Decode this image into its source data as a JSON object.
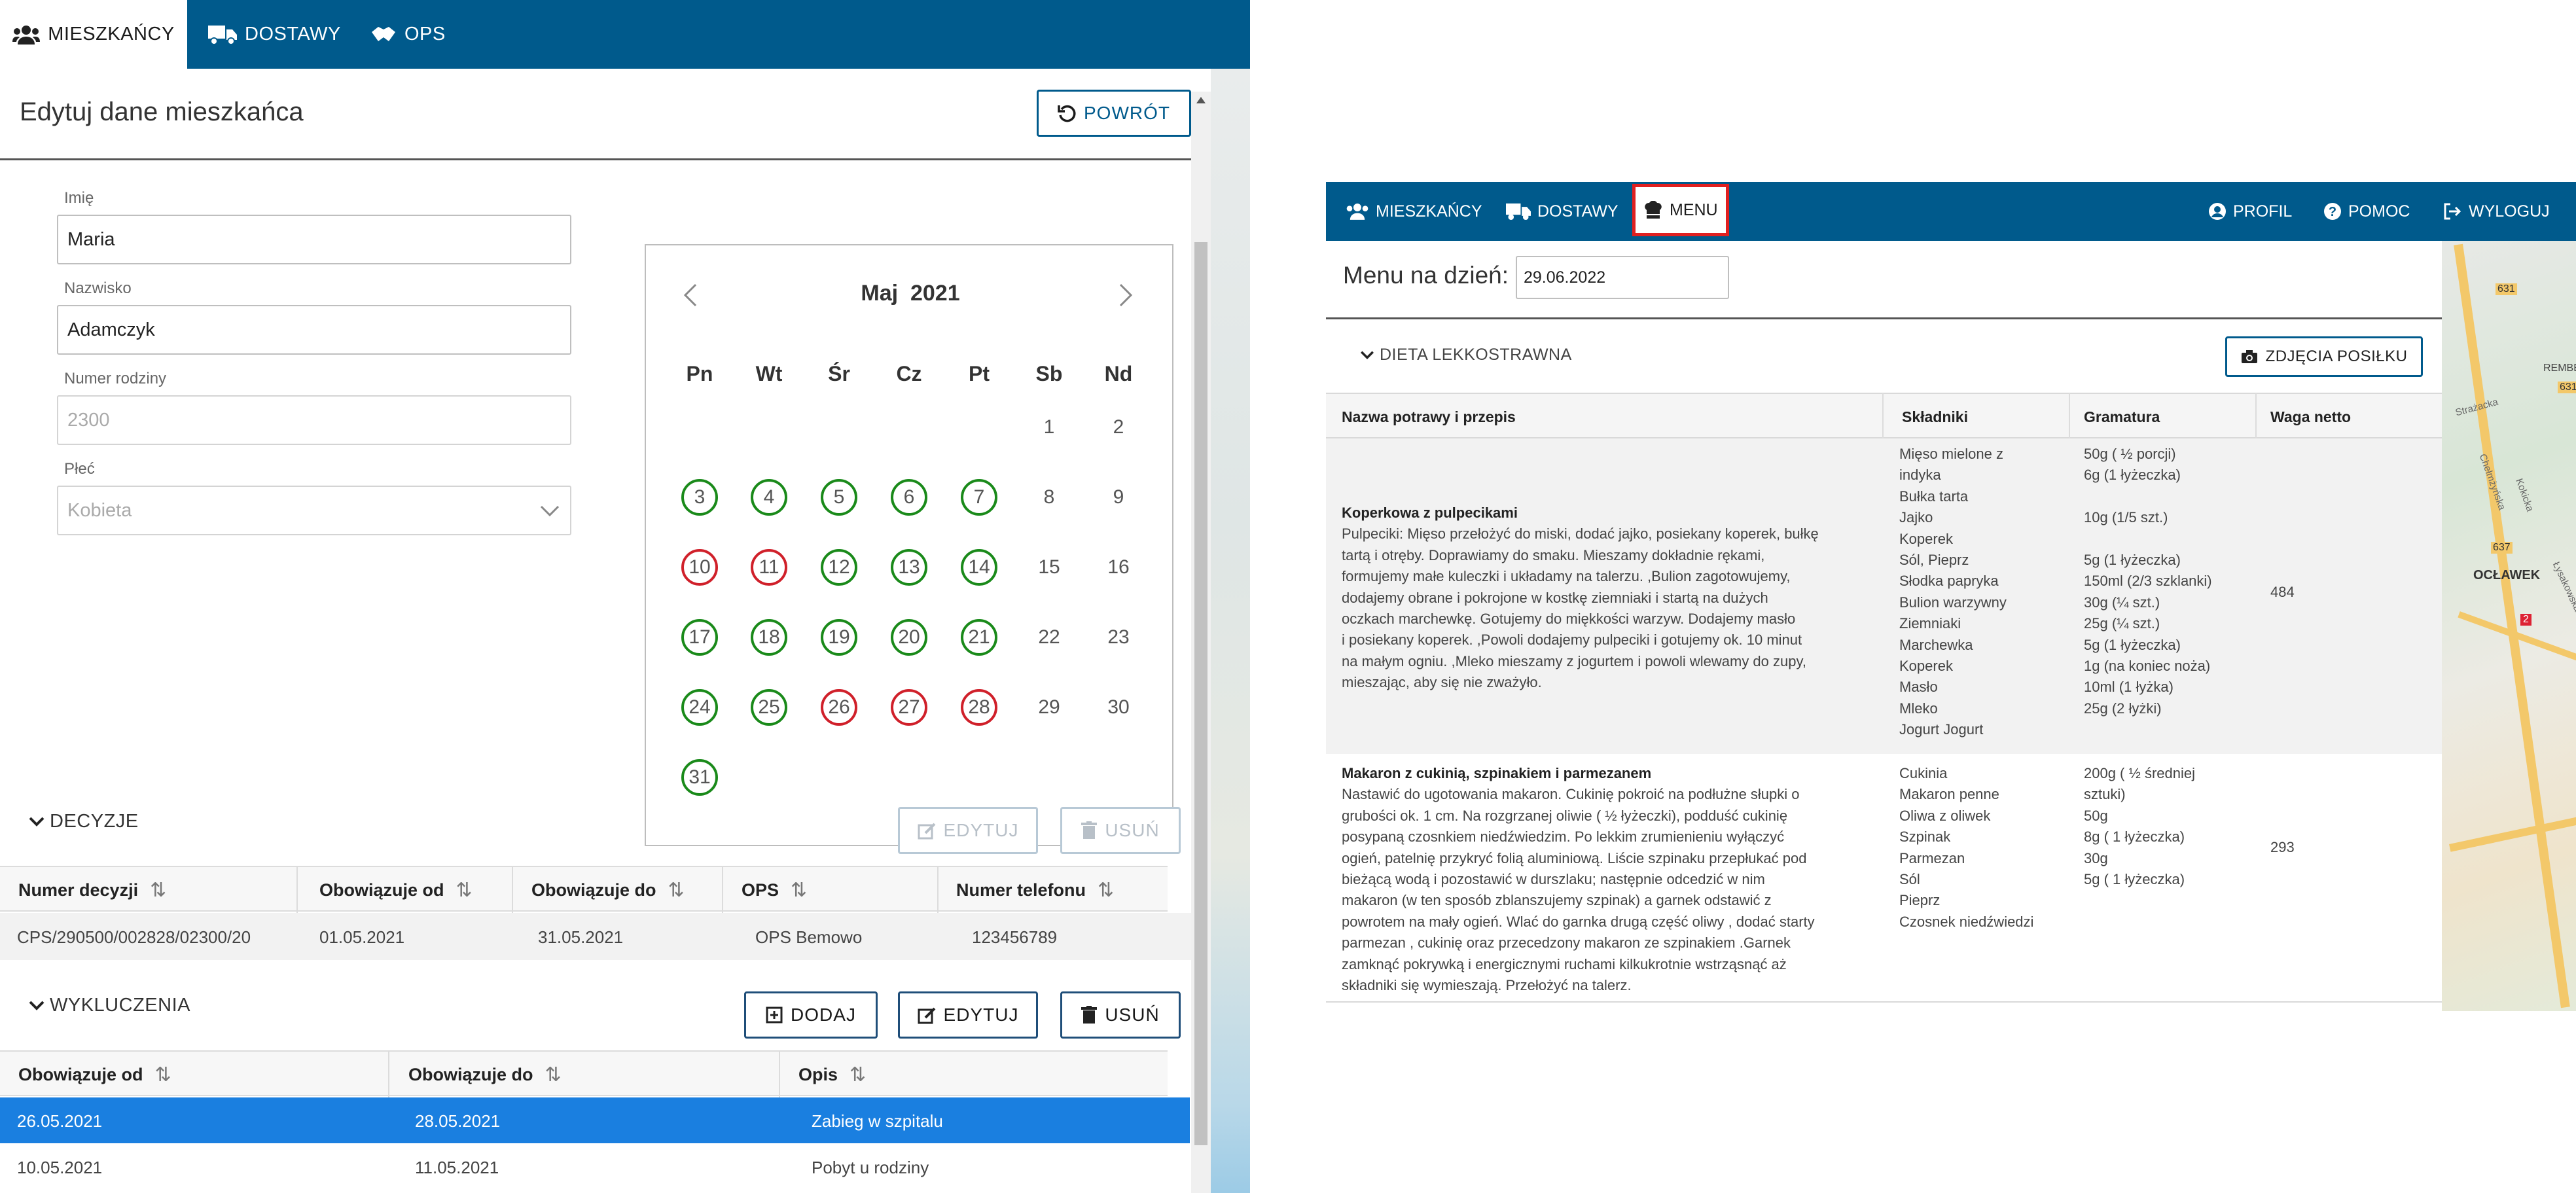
{
  "left": {
    "nav": [
      {
        "label": "MIESZKAŃCY",
        "icon": "users-icon",
        "active": true
      },
      {
        "label": "DOSTAWY",
        "icon": "truck-icon",
        "active": false
      },
      {
        "label": "OPS",
        "icon": "handshake-icon",
        "active": false
      }
    ],
    "page_title": "Edytuj dane mieszkańca",
    "back_button": "POWRÓT",
    "form": {
      "first_name_label": "Imię",
      "first_name_value": "Maria",
      "last_name_label": "Nazwisko",
      "last_name_value": "Adamczyk",
      "family_no_label": "Numer rodziny",
      "family_no_value": "2300",
      "sex_label": "Płeć",
      "sex_value": "Kobieta"
    },
    "calendar": {
      "month": "Maj",
      "year": "2021",
      "weekdays": [
        "Pn",
        "Wt",
        "Śr",
        "Cz",
        "Pt",
        "Sb",
        "Nd"
      ],
      "colors": {
        "green": "#1a8a1a",
        "red": "#d0202a"
      },
      "days": [
        {
          "d": "1",
          "s": ""
        },
        {
          "d": "2",
          "s": ""
        },
        {
          "d": "3",
          "s": "green"
        },
        {
          "d": "4",
          "s": "green"
        },
        {
          "d": "5",
          "s": "green"
        },
        {
          "d": "6",
          "s": "green"
        },
        {
          "d": "7",
          "s": "green"
        },
        {
          "d": "8",
          "s": ""
        },
        {
          "d": "9",
          "s": ""
        },
        {
          "d": "10",
          "s": "red"
        },
        {
          "d": "11",
          "s": "red"
        },
        {
          "d": "12",
          "s": "green"
        },
        {
          "d": "13",
          "s": "green"
        },
        {
          "d": "14",
          "s": "green"
        },
        {
          "d": "15",
          "s": ""
        },
        {
          "d": "16",
          "s": ""
        },
        {
          "d": "17",
          "s": "green"
        },
        {
          "d": "18",
          "s": "green"
        },
        {
          "d": "19",
          "s": "green"
        },
        {
          "d": "20",
          "s": "green"
        },
        {
          "d": "21",
          "s": "green"
        },
        {
          "d": "22",
          "s": ""
        },
        {
          "d": "23",
          "s": ""
        },
        {
          "d": "24",
          "s": "green"
        },
        {
          "d": "25",
          "s": "green"
        },
        {
          "d": "26",
          "s": "red"
        },
        {
          "d": "27",
          "s": "red"
        },
        {
          "d": "28",
          "s": "red"
        },
        {
          "d": "29",
          "s": ""
        },
        {
          "d": "30",
          "s": ""
        },
        {
          "d": "31",
          "s": "green"
        }
      ]
    },
    "decisions": {
      "title": "DECYZJE",
      "edit": "EDYTUJ",
      "delete": "USUŃ",
      "headers": [
        "Numer decyzji",
        "Obowiązuje od",
        "Obowiązuje do",
        "OPS",
        "Numer telefonu"
      ],
      "row": [
        "CPS/290500/002828/02300/20",
        "01.05.2021",
        "31.05.2021",
        "OPS Bemowo",
        "123456789"
      ]
    },
    "exclusions": {
      "title": "WYKLUCZENIA",
      "add": "DODAJ",
      "edit": "EDYTUJ",
      "delete": "USUŃ",
      "headers": [
        "Obowiązuje od",
        "Obowiązuje do",
        "Opis"
      ],
      "rows": [
        [
          "26.05.2021",
          "28.05.2021",
          "Zabieg w szpitalu"
        ],
        [
          "10.05.2021",
          "11.05.2021",
          "Pobyt u rodziny"
        ]
      ],
      "selected_color": "#1a7fe0"
    }
  },
  "right": {
    "nav": [
      {
        "label": "MIESZKAŃCY",
        "icon": "users-icon"
      },
      {
        "label": "DOSTAWY",
        "icon": "truck-icon"
      },
      {
        "label": "MENU",
        "icon": "chef-hat-icon",
        "active": true
      }
    ],
    "nav_right": [
      {
        "label": "PROFIL",
        "icon": "user-circle-icon"
      },
      {
        "label": "POMOC",
        "icon": "help-icon"
      },
      {
        "label": "WYLOGUJ",
        "icon": "logout-icon"
      }
    ],
    "menu_label": "Menu na dzień:",
    "menu_date": "29.06.2022",
    "diet": "DIETA LEKKOSTRAWNA",
    "photos_button": "ZDJĘCIA POSIŁKU",
    "headers": [
      "Nazwa potrawy i przepis",
      "Składniki",
      "Gramatura",
      "Waga netto"
    ],
    "dishes": [
      {
        "name": "Koperkowa z pulpecikami",
        "recipe": [
          "Pulpeciki: Mięso przełożyć do miski, dodać jajko, posiekany koperek, bułkę",
          "tartą i otręby. Doprawiamy do smaku. Mieszamy dokładnie rękami,",
          "formujemy małe kuleczki i układamy na talerzu.  ,Bulion zagotowujemy,",
          "dodajemy obrane i pokrojone w kostkę ziemniaki i startą na dużych",
          "oczkach marchewkę. Gotujemy do miękkości warzyw. Dodajemy masło",
          "i posiekany koperek.  ,Powoli dodajemy pulpeciki i gotujemy ok. 10 minut",
          "na małym ogniu. ,Mleko mieszamy z jogurtem i powoli wlewamy do zupy,",
          "mieszając, aby się nie zważyło."
        ],
        "ingredients": [
          "Mięso mielone z",
          "indyka",
          "Bułka tarta",
          "Jajko",
          "Koperek",
          "Sól, Pieprz",
          "Słodka papryka",
          "Bulion warzywny",
          "Ziemniaki",
          "Marchewka",
          "Koperek",
          "Masło",
          "Mleko",
          "Jogurt Jogurt"
        ],
        "amounts": [
          "50g ( ½ porcji)",
          "6g (1 łyżeczka)",
          "",
          "10g (1/5 szt.)",
          "",
          "5g (1 łyżeczka)",
          "150ml (2/3 szklanki)",
          "30g (¼ szt.)",
          "25g (¼ szt.)",
          "5g (1 łyżeczka)",
          "1g (na koniec noża)",
          "10ml (1 łyżka)",
          "25g (2 łyżki)",
          ""
        ],
        "weight": "484"
      },
      {
        "name": "Makaron z cukinią, szpinakiem i parmezanem",
        "recipe": [
          "Nastawić do ugotowania makaron. Cukinię pokroić na podłużne słupki o",
          "grubości ok. 1 cm. Na rozgrzanej oliwie ( ½ łyżeczki), podduść cukinię",
          "posypaną czosnkiem niedźwiedzim. Po lekkim zrumienieniu wyłączyć",
          "ogień, patelnię przykryć folią aluminiową. Liście szpinaku przepłukać pod",
          "bieżącą wodą i pozostawić w durszlaku; następnie odcedzić w nim",
          "makaron (w ten sposób zblanszujemy szpinak) a garnek odstawić z",
          "powrotem na mały ogień. Wlać do garnka drugą część oliwy , dodać starty",
          "parmezan , cukinię oraz przecedzony makaron ze szpinakiem .Garnek",
          "zamknąć pokrywką i energicznymi ruchami kilkukrotnie wstrząsnąć aż",
          "składniki się wymieszają. Przełożyć na talerz."
        ],
        "ingredients": [
          "Cukinia",
          "Makaron penne",
          "Oliwa z oliwek",
          "Szpinak",
          "Parmezan",
          "Sól",
          "Pieprz",
          "Czosnek niedźwiedzi"
        ],
        "amounts": [
          "200g ( ½ średniej",
          "sztuki)",
          "50g",
          "8g ( 1 łyżeczka)",
          "30g",
          "5g ( 1 łyżeczka)",
          "",
          ""
        ],
        "weight": "293"
      }
    ],
    "map_labels": [
      "631",
      "REMBER",
      "Strażacka",
      "631",
      "Chełmżyńska",
      "Kokicka",
      "637",
      "OCŁAWEK",
      "Łysakowska",
      "2"
    ]
  }
}
